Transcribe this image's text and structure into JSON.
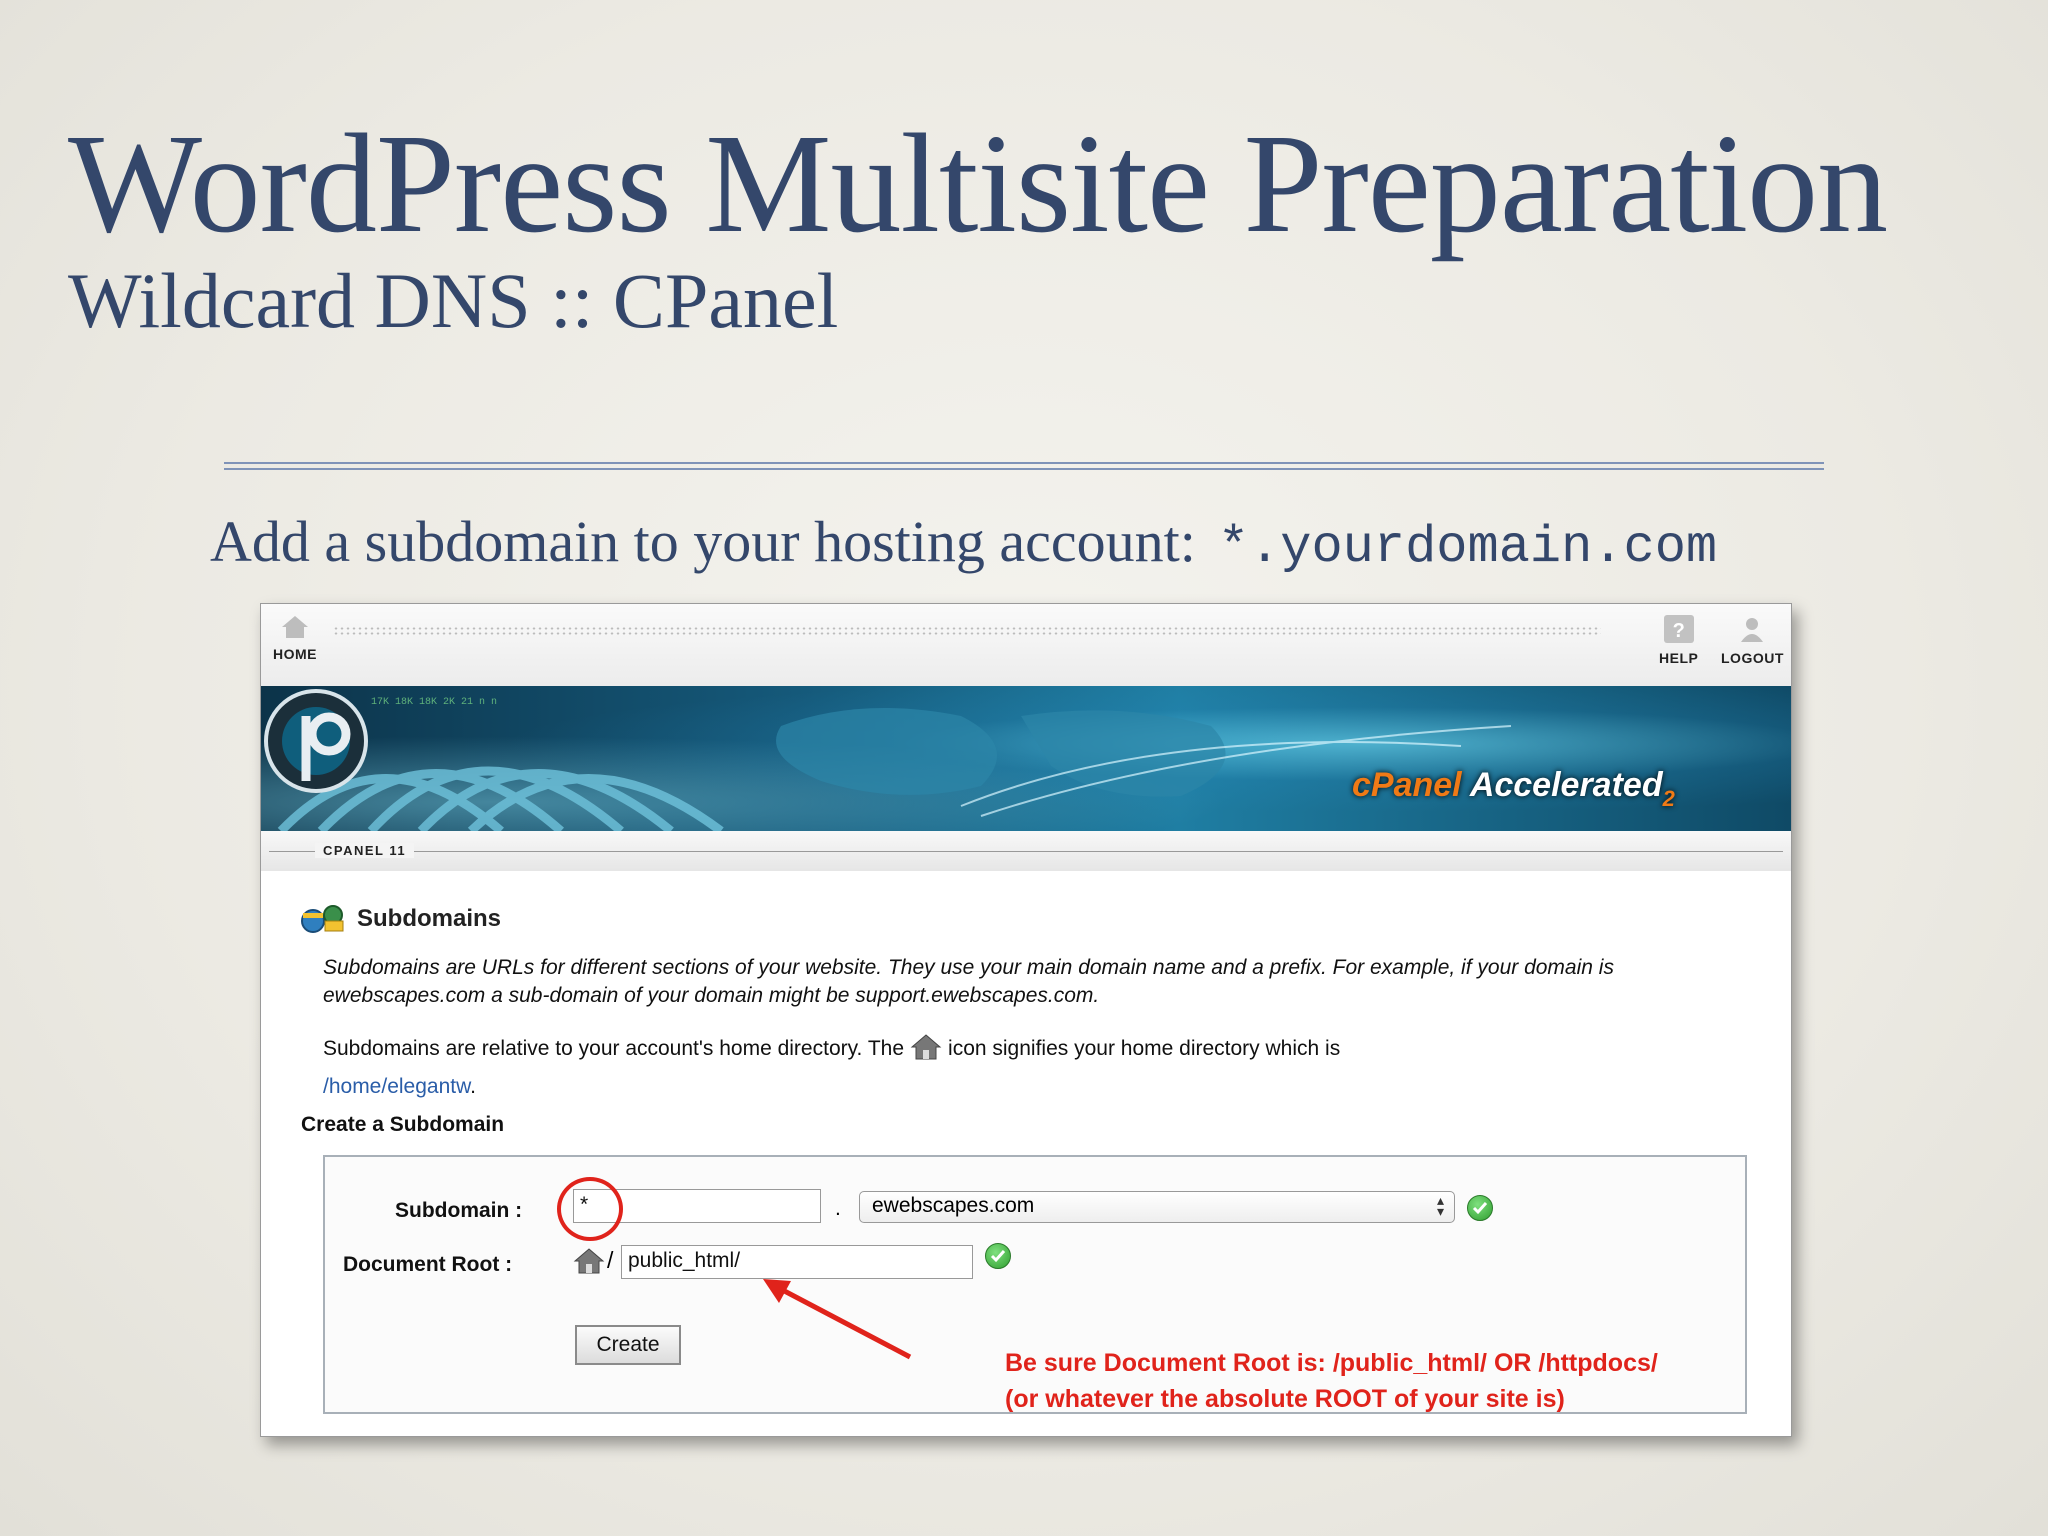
{
  "slide": {
    "title": "WordPress Multisite Preparation",
    "subtitle": "Wildcard DNS :: CPanel",
    "intro_text": "Add a subdomain to your hosting account:",
    "intro_code": "*.yourdomain.com"
  },
  "cpanel": {
    "topbar": {
      "home_label": "HOME",
      "help_label": "HELP",
      "logout_label": "LOGOUT"
    },
    "banner": {
      "brand": "cPanel",
      "product": "Accelerated",
      "version_mark": "2"
    },
    "version_label": "CPANEL 11",
    "section_title": "Subdomains",
    "description_1": "Subdomains are URLs for different sections of your website. They use your main domain name and a prefix. For example, if your domain is ewebscapes.com a sub-domain of your domain might be support.ewebscapes.com.",
    "description_2_before": "Subdomains are relative to your account's home directory. The",
    "description_2_after": "icon signifies your home directory which is",
    "home_path": "/home/elegantw",
    "home_path_suffix": ".",
    "create_heading": "Create a Subdomain",
    "form": {
      "subdomain_label": "Subdomain :",
      "subdomain_value": "*",
      "separator": ".",
      "domain_selected": "ewebscapes.com",
      "docroot_label": "Document Root :",
      "docroot_slash": "/",
      "docroot_value": "public_html/",
      "create_label": "Create"
    },
    "annotation": {
      "line1": "Be sure Document Root is:  /public_html/  OR /httpdocs/",
      "line2": "(or whatever the absolute ROOT of your site is)",
      "color": "#e0231b"
    }
  }
}
